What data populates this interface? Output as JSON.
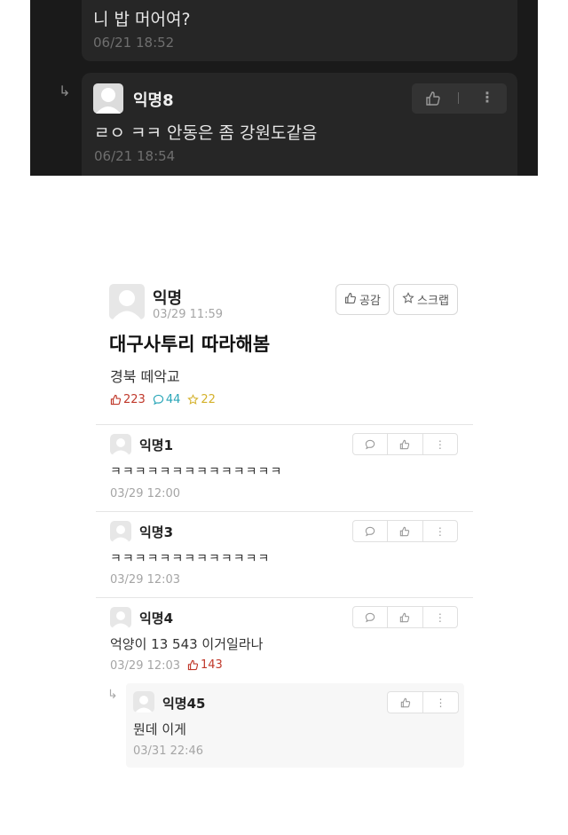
{
  "dark_thread": {
    "comment_prev": {
      "text": "니 밥 머어여?",
      "time": "06/21 18:52"
    },
    "reply": {
      "author": "익명8",
      "text": "ㄹㅇ ㅋㅋ 안동은 좀 강원도같음",
      "time": "06/21 18:54"
    }
  },
  "post": {
    "author": "익명",
    "time": "03/29 11:59",
    "buttons": {
      "empathy": "공감",
      "scrap": "스크랩"
    },
    "title": "대구사투리 따라해봄",
    "body": "경북 떼악교",
    "stats": {
      "likes": "223",
      "comments": "44",
      "scraps": "22"
    },
    "colors": {
      "like": "#c0392b",
      "comment": "#2aa6b8",
      "scrap": "#d4b12a"
    }
  },
  "comments": [
    {
      "author": "익명1",
      "text": "ㅋㅋㅋㅋㅋㅋㅋㅋㅋㅋㅋㅋㅋㅋ",
      "time": "03/29 12:00"
    },
    {
      "author": "익명3",
      "text": "ㅋㅋㅋㅋㅋㅋㅋㅋㅋㅋㅋㅋㅋ",
      "time": "03/29 12:03"
    },
    {
      "author": "익명4",
      "text": "억양이 13 543 이거일라나",
      "time": "03/29 12:03",
      "likes": "143"
    }
  ],
  "reply": {
    "author": "익명45",
    "text": "뭔데 이게",
    "time": "03/31 22:46"
  },
  "icons": {
    "reply_arrow": "reply-arrow-icon",
    "like": "thumbs-up-icon",
    "comment": "speech-bubble-icon",
    "scrap": "star-icon",
    "more": "vertical-dots-icon"
  }
}
